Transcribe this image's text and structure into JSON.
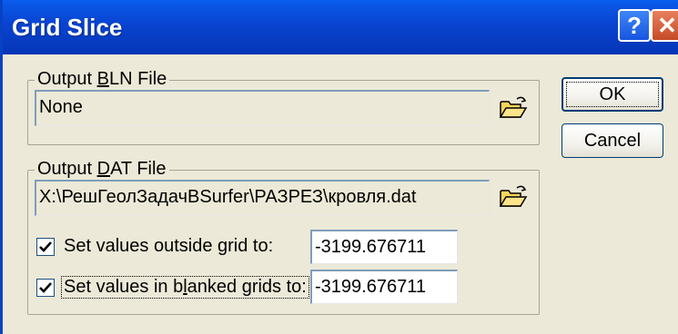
{
  "window": {
    "title": "Grid Slice",
    "help_label": "?",
    "close_label": "✕"
  },
  "bln_group": {
    "legend_pre": "Output ",
    "legend_mnemonic": "B",
    "legend_post": "LN File",
    "path_value": "None",
    "folder_icon": "open-folder-icon"
  },
  "dat_group": {
    "legend_pre": "Output ",
    "legend_mnemonic": "D",
    "legend_post": "AT File",
    "path_value": "X:\\РешГеолЗадачBSurfer\\РАЗРЕЗ\\кровля.dat",
    "folder_icon": "open-folder-icon",
    "outside": {
      "checked": true,
      "label": "Set values outside grid to:",
      "value": "-3199.676711"
    },
    "blanked": {
      "checked": true,
      "label_pre": "Set values in b",
      "label_mnemonic": "l",
      "label_post": "anked grids to:",
      "value": "-3199.676711"
    }
  },
  "buttons": {
    "ok": "OK",
    "cancel": "Cancel"
  },
  "colors": {
    "titlebar": "#0842c4",
    "dialog_bg": "#ece9d8",
    "button_border": "#003c74",
    "field_border": "#7f9db9"
  }
}
